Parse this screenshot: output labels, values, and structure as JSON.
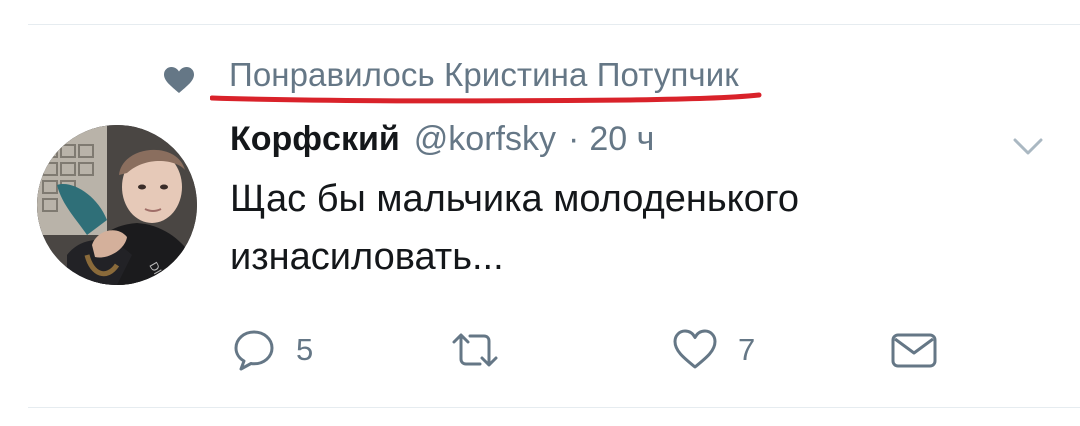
{
  "social_context": {
    "icon": "heart-icon",
    "text": "Понравилось Кристина Потупчик"
  },
  "tweet": {
    "author_name": "Корфский",
    "author_handle": "@korfsky",
    "separator": "·",
    "timestamp": "20 ч",
    "text_lines": [
      "Щас бы мальчика молоденького",
      "изнасиловать..."
    ]
  },
  "actions": {
    "reply_count": "5",
    "retweet_count": "",
    "like_count": "7",
    "dm_label": ""
  },
  "colors": {
    "text_primary": "#14171a",
    "text_secondary": "#657786",
    "icon_gray": "#657786",
    "underline_red": "#d9222a",
    "divider": "#e6ecf0"
  }
}
